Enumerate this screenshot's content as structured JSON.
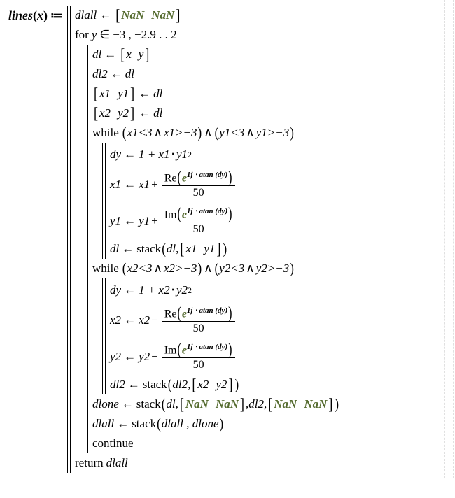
{
  "func": {
    "name": "lines",
    "arg": "x",
    "assign_op": "≔"
  },
  "nan": "NaN",
  "l_dlall_init_lhs": "dlall",
  "arrow": "←",
  "l_for_kw": "for",
  "l_for_var": "y",
  "l_for_in": "∈",
  "l_for_range": "−3 , −2.9 . . 2",
  "l_dl_lhs": "dl",
  "l_dl_cells": [
    "x",
    "y"
  ],
  "l_dl2_lhs": "dl2",
  "l_dl2_rhs": "dl",
  "l_xy1_cells": [
    "x1",
    "y1"
  ],
  "l_xy1_rhs": "dl",
  "l_xy2_cells": [
    "x2",
    "y2"
  ],
  "l_xy2_rhs": "dl",
  "while_kw": "while",
  "cond1": {
    "a": "x1<3",
    "b": "x1>−3",
    "c": "y1<3",
    "d": "y1>−3"
  },
  "cond2": {
    "a": "x2<3",
    "b": "x2>−3",
    "c": "y2<3",
    "d": "y2>−3"
  },
  "dy_lhs": "dy",
  "dy1_rhs_pre": "1 + x1",
  "dy1_rhs_post": "y1",
  "dy2_rhs_pre": "1 + x2",
  "dy2_rhs_post": "y2",
  "x1_lhs": "x1",
  "x1_base": "x1",
  "y1_lhs": "y1",
  "y1_base": "y1",
  "x2_lhs": "x2",
  "x2_base": "x2",
  "y2_lhs": "y2",
  "y2_base": "y2",
  "op_plus": "+",
  "op_minus": "−",
  "Re": "Re",
  "Im": "Im",
  "exp_base": "e",
  "exp_sup": "1j ⋅ atan (dy)",
  "denom": "50",
  "stack": "stack",
  "dl_stack_cells": [
    "x1",
    "y1"
  ],
  "dl2_stack_cells": [
    "x2",
    "y2"
  ],
  "dlone_lhs": "dlone",
  "dlall_lhs": "dlall",
  "dlone_args_text": "dl , [NaN NaN] , dl2 , [NaN NaN]",
  "dlall_args": "dlall , dlone",
  "continue_kw": "continue",
  "return_kw": "return",
  "return_var": "dlall",
  "square": "2"
}
